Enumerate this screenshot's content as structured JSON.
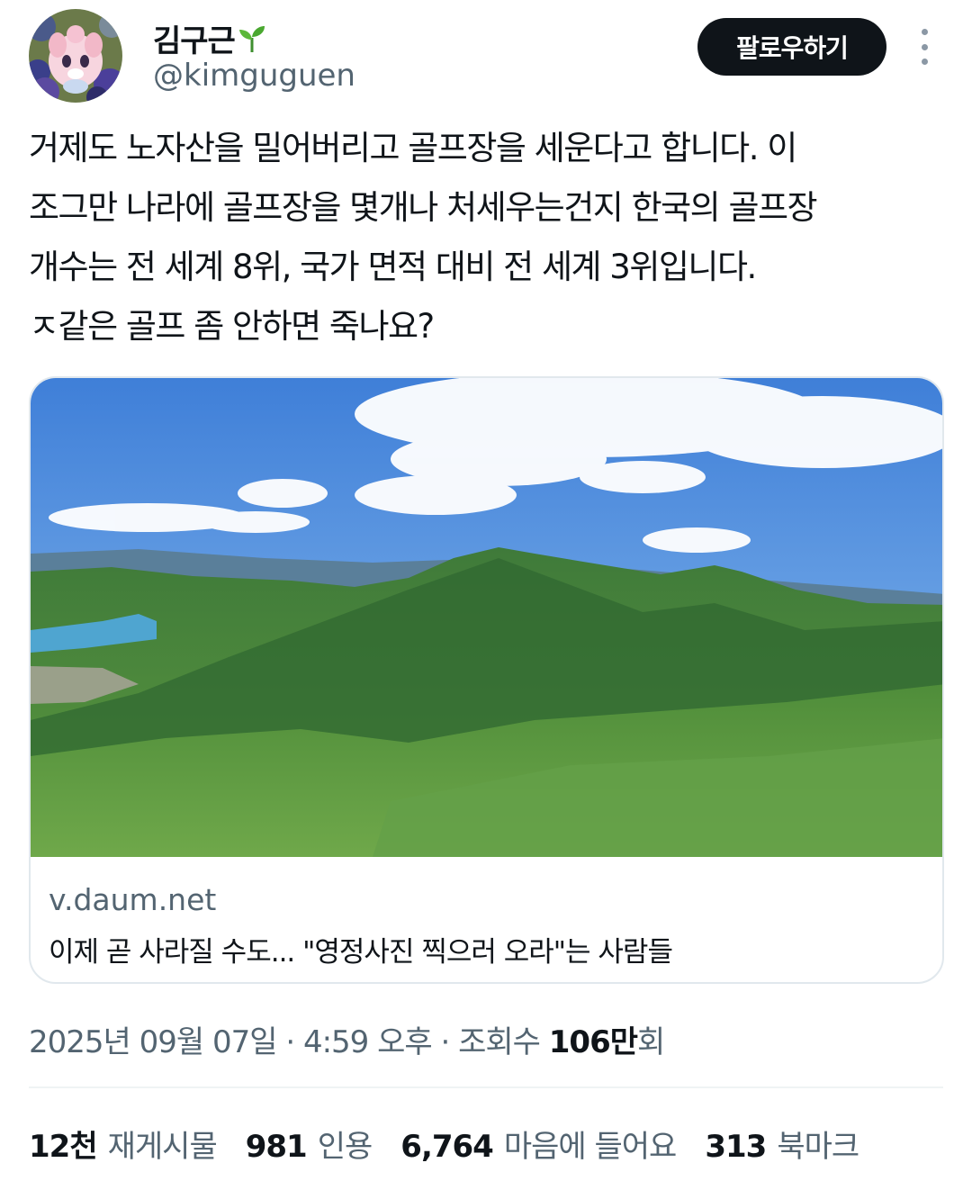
{
  "author": {
    "display_name": "김구근",
    "handle": "@kimguguen",
    "avatar_icon": "avatar-character-icon",
    "badge_icon": "sprout-icon"
  },
  "actions": {
    "follow_label": "팔로우하기",
    "more_icon": "more-vertical-icon"
  },
  "tweet": {
    "lines": [
      "거제도 노자산을 밀어버리고 골프장을 세운다고 합니다. 이",
      "조그만 나라에 골프장을 몇개나 처세우는건지 한국의 골프장",
      "개수는 전 세계 8위, 국가 면적 대비 전 세계 3위입니다.",
      "ㅈ같은 골프 좀 안하면 죽나요?"
    ]
  },
  "link_card": {
    "domain": "v.daum.net",
    "title": "이제 곧 사라질 수도... \"영정사진 찍으러 오라\"는 사람들"
  },
  "meta": {
    "date": "2025년 09월 07일",
    "sep1": " · ",
    "time": "4:59 오후",
    "sep2": " · ",
    "views_label": "조회수 ",
    "views_value": "106만",
    "views_suffix": "회"
  },
  "stats": [
    {
      "value": "12천",
      "label": "재게시물"
    },
    {
      "value": "981",
      "label": "인용"
    },
    {
      "value": "6,764",
      "label": "마음에 들어요"
    },
    {
      "value": "313",
      "label": "북마크"
    }
  ],
  "colors": {
    "text_primary": "#0f1419",
    "text_secondary": "#536471",
    "button_bg": "#0f1419",
    "border": "#e1e8ed"
  }
}
